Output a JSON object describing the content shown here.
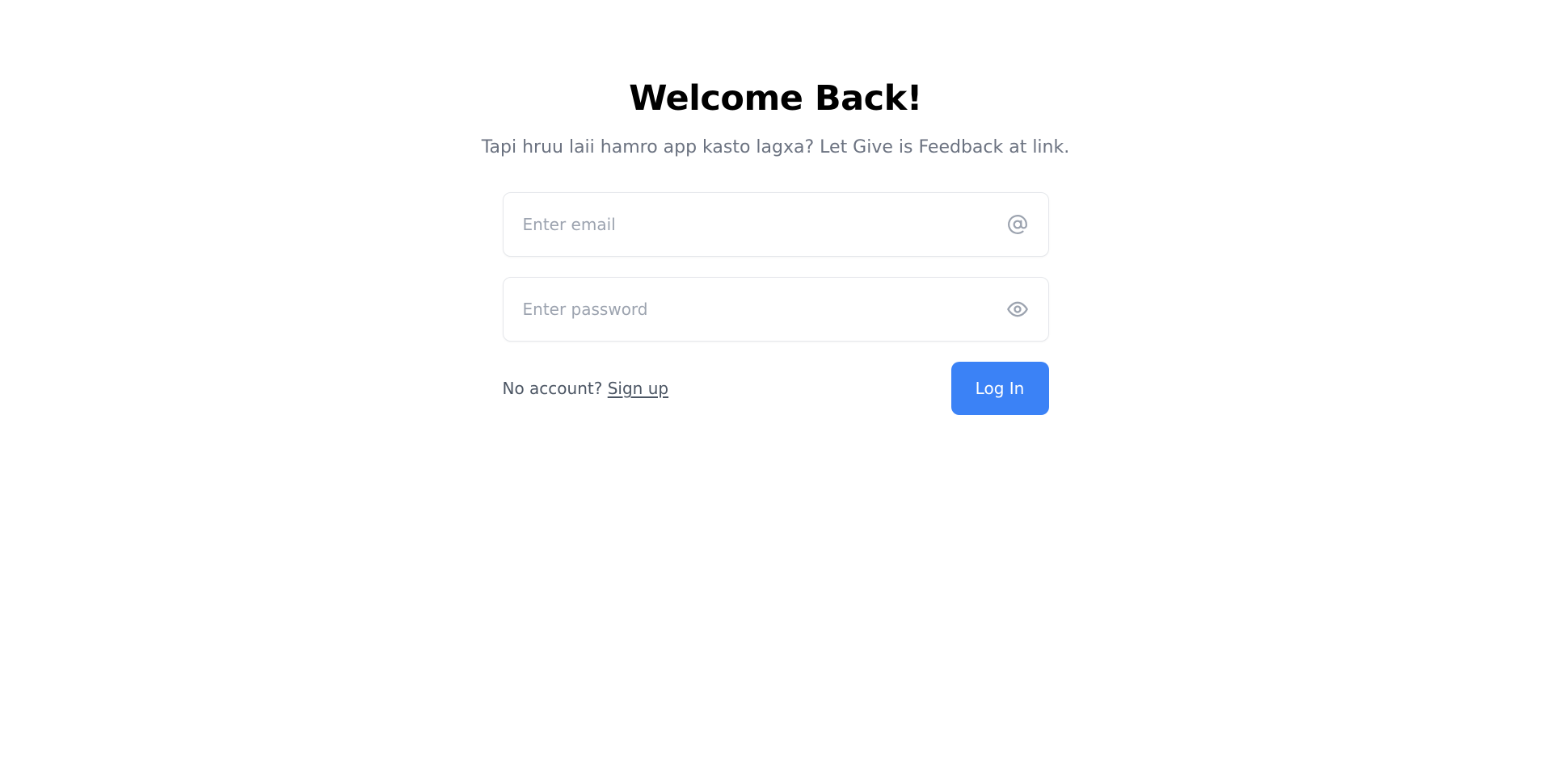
{
  "login": {
    "title": "Welcome Back!",
    "subtitle": "Tapi hruu laii hamro app kasto lagxa? Let Give is Feedback at link.",
    "email": {
      "placeholder": "Enter email",
      "value": "",
      "icon": "at-sign-icon"
    },
    "password": {
      "placeholder": "Enter password",
      "value": "",
      "icon": "eye-icon"
    },
    "no_account_text": "No account?",
    "signup_link": "Sign up",
    "login_button": "Log In"
  },
  "colors": {
    "accent": "#3b82f6",
    "title": "#000000",
    "subtitle": "#6b7280",
    "border": "#e5e7eb",
    "placeholder": "#9ca3af",
    "icon": "#9ca3af"
  }
}
